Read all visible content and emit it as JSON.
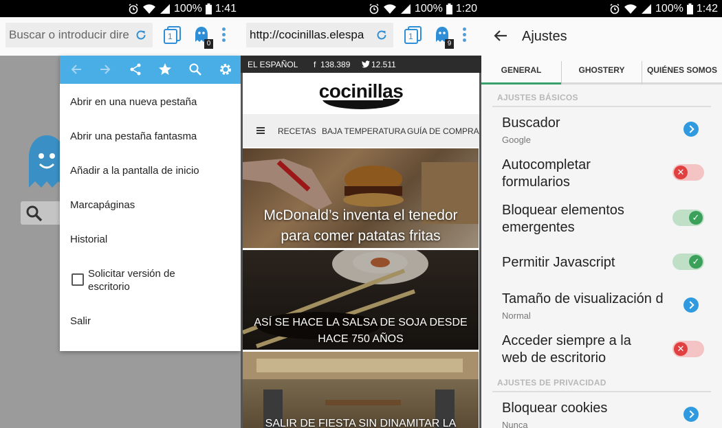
{
  "colors": {
    "accent_blue": "#4aaee6",
    "green_on": "#3aa05a",
    "red_off": "#e04040",
    "tab_underline": "#37a06b"
  },
  "panel1": {
    "status": {
      "battery": "100%",
      "time": "1:41"
    },
    "url_placeholder": "Buscar o introducir dire",
    "tab_count": "1",
    "ghost_badge": "0",
    "menu_bar_icons": [
      "back-arrow-icon",
      "forward-arrow-icon",
      "share-icon",
      "star-icon",
      "search-icon",
      "gear-icon"
    ],
    "menu": {
      "new_tab": "Abrir en una nueva pestaña",
      "ghost_tab": "Abrir una pestaña fantasma",
      "add_home": "Añadir a la pantalla de inicio",
      "bookmarks": "Marcapáginas",
      "history": "Historial",
      "desktop_line1": "Solicitar versión de",
      "desktop_line2": "escritorio",
      "exit": "Salir"
    }
  },
  "panel2": {
    "status": {
      "battery": "100%",
      "time": "1:20"
    },
    "url": "http://cocinillas.elespa",
    "tab_count": "1",
    "ghost_badge": "9",
    "top_strip": {
      "site": "EL ESPAÑOL",
      "facebook_count": "138.389",
      "twitter_count": "12.511"
    },
    "logo": "cocinillas",
    "nav": {
      "recipes": "RECETAS",
      "low_temp": "BAJA TEMPERATURA",
      "buying_guide": "GUÍA DE COMPRA"
    },
    "articles": [
      {
        "line1": "McDonald’s inventa el tenedor",
        "line2": "para comer patatas fritas"
      },
      {
        "line1": "ASÍ SE HACE LA SALSA DE SOJA DESDE",
        "line2": "HACE 750 AÑOS"
      },
      {
        "line1": "SALIR DE FIESTA SIN DINAMITAR LA"
      }
    ]
  },
  "panel3": {
    "status": {
      "battery": "100%",
      "time": "1:42"
    },
    "title": "Ajustes",
    "tabs": [
      "GENERAL",
      "GHOSTERY",
      "QUIÉNES SOMOS"
    ],
    "section_basic": "AJUSTES BÁSICOS",
    "section_privacy": "AJUSTES DE PRIVACIDAD",
    "settings": {
      "search_engine": {
        "title": "Buscador",
        "sub": "Google"
      },
      "autofill": {
        "line1": "Autocompletar",
        "line2": "formularios",
        "state": "off"
      },
      "popups": {
        "line1": "Bloquear elementos",
        "line2": "emergentes",
        "state": "on"
      },
      "javascript": {
        "title": "Permitir Javascript",
        "state": "on"
      },
      "display_size": {
        "title": "Tamaño de visualización d",
        "sub": "Normal"
      },
      "desktop": {
        "line1": "Acceder siempre a la",
        "line2": "web de escritorio",
        "state": "off"
      },
      "cookies": {
        "title": "Bloquear cookies",
        "sub": "Nunca"
      }
    }
  }
}
